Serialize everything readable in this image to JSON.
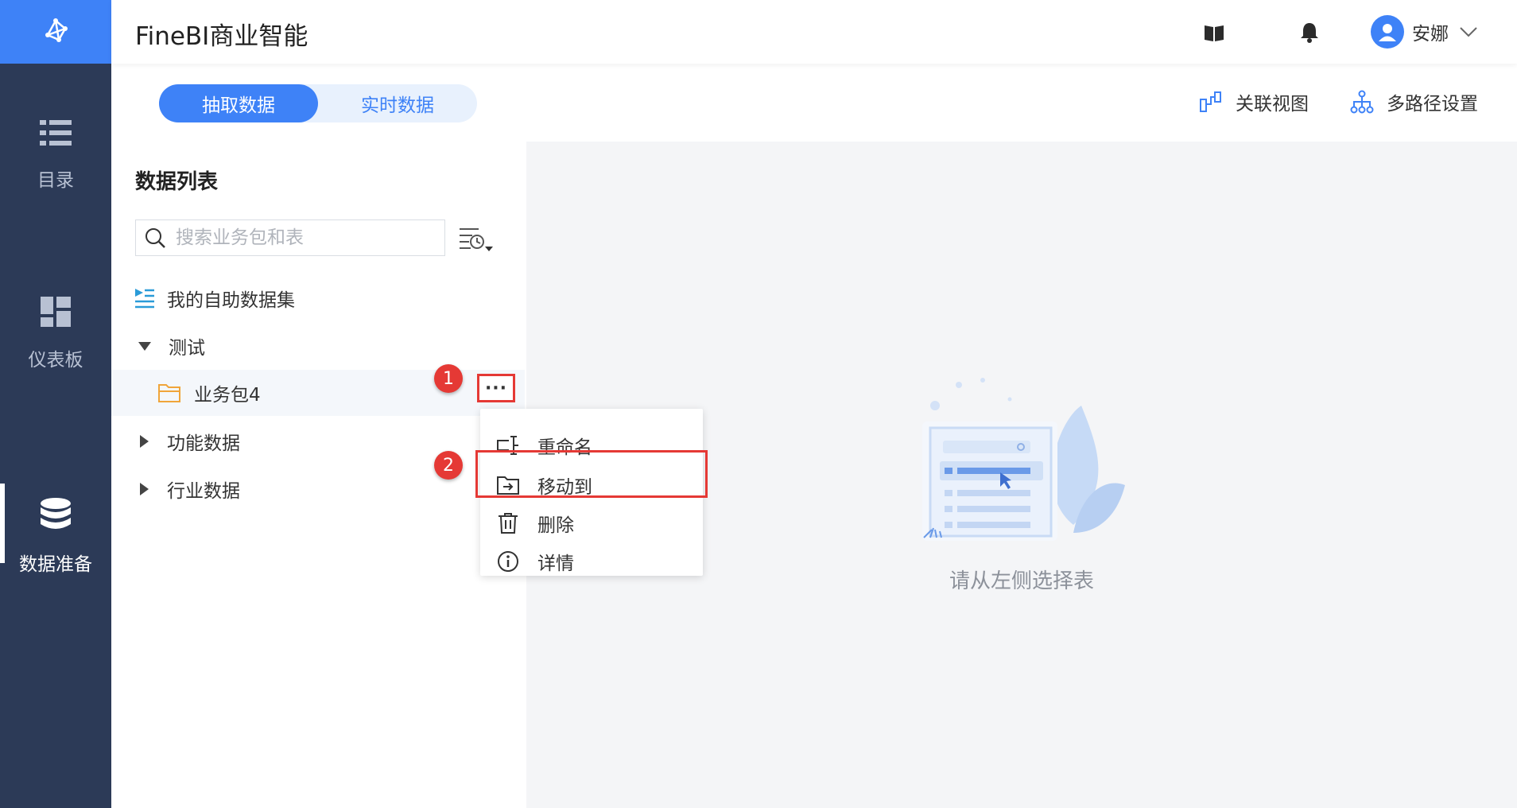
{
  "app": {
    "title": "FineBI商业智能"
  },
  "leftnav": {
    "items": [
      {
        "label": "目录",
        "icon": "list-icon"
      },
      {
        "label": "仪表板",
        "icon": "dashboard-icon"
      },
      {
        "label": "数据准备",
        "icon": "database-icon",
        "active": true
      }
    ]
  },
  "header": {
    "user_name": "安娜",
    "icons": [
      "book-icon",
      "bell-icon",
      "avatar-icon",
      "chevron-down-icon"
    ]
  },
  "tabs": {
    "extract": "抽取数据",
    "realtime": "实时数据",
    "active": "extract"
  },
  "toolbar": {
    "relation_view": "关联视图",
    "multipath": "多路径设置"
  },
  "data_panel": {
    "title": "数据列表",
    "search_placeholder": "搜索业务包和表",
    "tree": [
      {
        "label": "我的自助数据集",
        "type": "self-dataset"
      },
      {
        "label": "测试",
        "type": "group",
        "expanded": true
      },
      {
        "label": "业务包4",
        "type": "package",
        "selected": true
      },
      {
        "label": "功能数据",
        "type": "group",
        "expanded": false
      },
      {
        "label": "行业数据",
        "type": "group",
        "expanded": false
      }
    ]
  },
  "more_button": {
    "label": "···"
  },
  "context_menu": {
    "items": [
      {
        "label": "重命名",
        "icon": "rename-icon"
      },
      {
        "label": "移动到",
        "icon": "move-to-icon",
        "highlighted": true
      },
      {
        "label": "删除",
        "icon": "trash-icon"
      },
      {
        "label": "详情",
        "icon": "info-icon"
      }
    ]
  },
  "annotations": {
    "step1": "1",
    "step2": "2"
  },
  "empty_state": {
    "text": "请从左侧选择表"
  },
  "colors": {
    "accent": "#3e82f7",
    "nav_bg": "#2c3a57",
    "annotation_red": "#e53935"
  }
}
